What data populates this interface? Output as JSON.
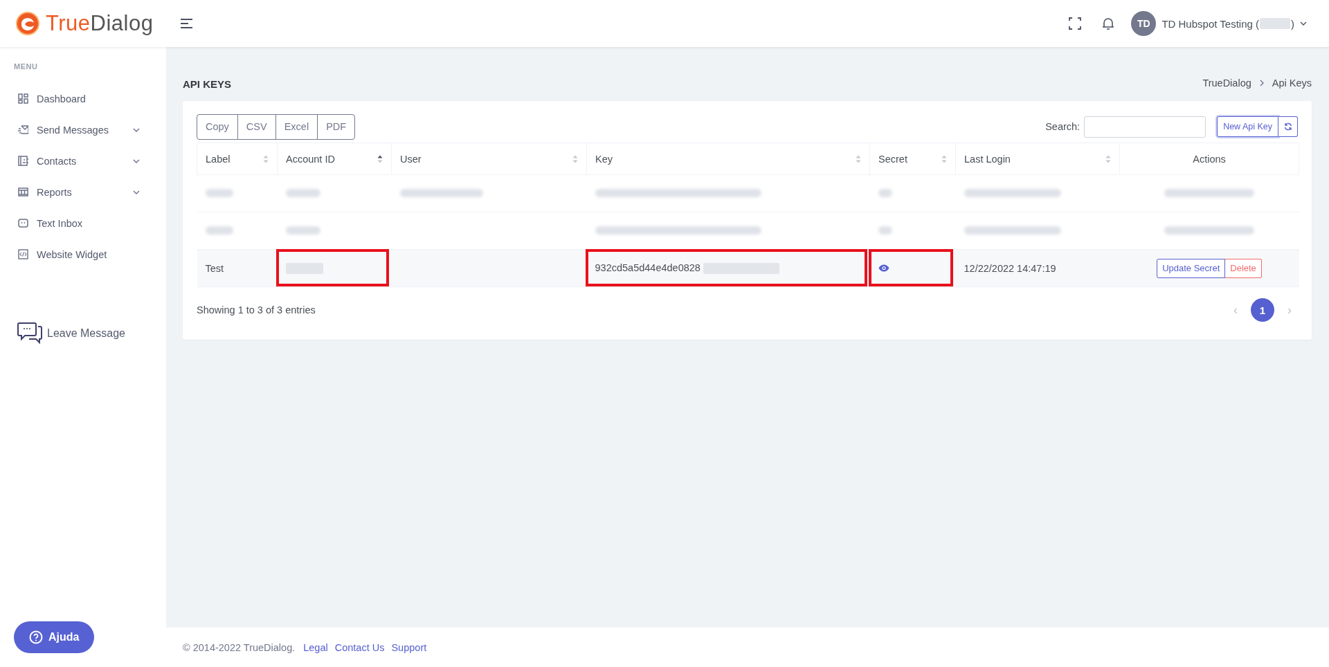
{
  "header": {
    "logo": {
      "part1": "True",
      "part2": "Dialog"
    },
    "user": {
      "initials": "TD",
      "name_prefix": "TD Hubspot Testing (",
      "name_suffix": ")"
    }
  },
  "sidebar": {
    "heading": "MENU",
    "items": [
      {
        "label": "Dashboard",
        "expandable": false
      },
      {
        "label": "Send Messages",
        "expandable": true
      },
      {
        "label": "Contacts",
        "expandable": true
      },
      {
        "label": "Reports",
        "expandable": true
      },
      {
        "label": "Text Inbox",
        "expandable": false
      },
      {
        "label": "Website Widget",
        "expandable": false
      }
    ],
    "leave_message": "Leave Message",
    "help_button": "Ajuda"
  },
  "page": {
    "title": "API KEYS",
    "breadcrumb": [
      {
        "label": "TrueDialog"
      },
      {
        "label": "Api Keys"
      }
    ]
  },
  "toolbar": {
    "export_buttons": [
      "Copy",
      "CSV",
      "Excel",
      "PDF"
    ],
    "search_label": "Search:",
    "new_button": "New Api Key"
  },
  "table": {
    "columns": [
      {
        "label": "Label",
        "sortable": true,
        "sorted_ascending": false
      },
      {
        "label": "Account ID",
        "sortable": true,
        "sorted_ascending": true
      },
      {
        "label": "User",
        "sortable": true,
        "sorted_ascending": false
      },
      {
        "label": "Key",
        "sortable": true,
        "sorted_ascending": false
      },
      {
        "label": "Secret",
        "sortable": true,
        "sorted_ascending": false
      },
      {
        "label": "Last Login",
        "sortable": true,
        "sorted_ascending": false
      },
      {
        "label": "Actions",
        "sortable": false
      }
    ],
    "rows": [
      {
        "kind": "blurred"
      },
      {
        "kind": "blurred"
      },
      {
        "kind": "normal",
        "hovered": true,
        "label": "Test",
        "account_id": {
          "hidden": true,
          "highlighted": true
        },
        "key": {
          "text": "932cd5a5d44e4de0828",
          "hidden_tail": true,
          "highlighted": true
        },
        "secret": {
          "highlighted": true
        },
        "last_login": "12/22/2022 14:47:19",
        "actions": [
          "Update Secret",
          "Delete"
        ]
      }
    ],
    "info": "Showing 1 to 3 of 3 entries"
  },
  "pagination": {
    "prev": "‹",
    "pages": [
      {
        "label": "1",
        "selected": true
      }
    ],
    "next": "›"
  },
  "footer": {
    "copyright": "© 2014-2022 TrueDialog.",
    "links": [
      "Legal",
      "Contact Us",
      "Support"
    ]
  }
}
